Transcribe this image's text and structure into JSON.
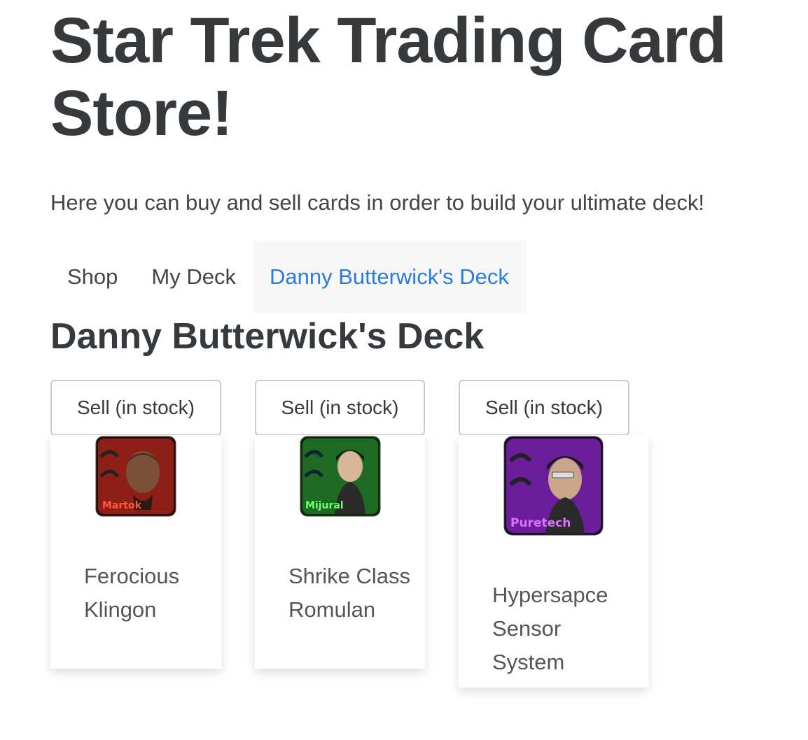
{
  "header": {
    "title": "Star Trek Trading Card Store!",
    "subtitle": "Here you can buy and sell cards in order to build your ultimate deck!"
  },
  "nav": {
    "tabs": [
      {
        "label": "Shop",
        "active": false
      },
      {
        "label": "My Deck",
        "active": false
      },
      {
        "label": "Danny Butterwick's Deck",
        "active": true
      }
    ]
  },
  "deck": {
    "title": "Danny Butterwick's Deck",
    "cards": [
      {
        "button": "Sell (in stock)",
        "portrait_label": "Martok",
        "name": "Ferocious Klingon",
        "theme": "#c0392b"
      },
      {
        "button": "Sell (in stock)",
        "portrait_label": "Mijural",
        "name": "Shrike Class Romulan",
        "theme": "#3fae3f"
      },
      {
        "button": "Sell (in stock)",
        "portrait_label": "Puretech",
        "name": "Hypersapce Sensor System",
        "theme": "#a040d8"
      }
    ]
  },
  "colors": {
    "accent": "#2a7ae2",
    "text": "#373a3c",
    "tab_active_bg": "#f7f7f7"
  }
}
